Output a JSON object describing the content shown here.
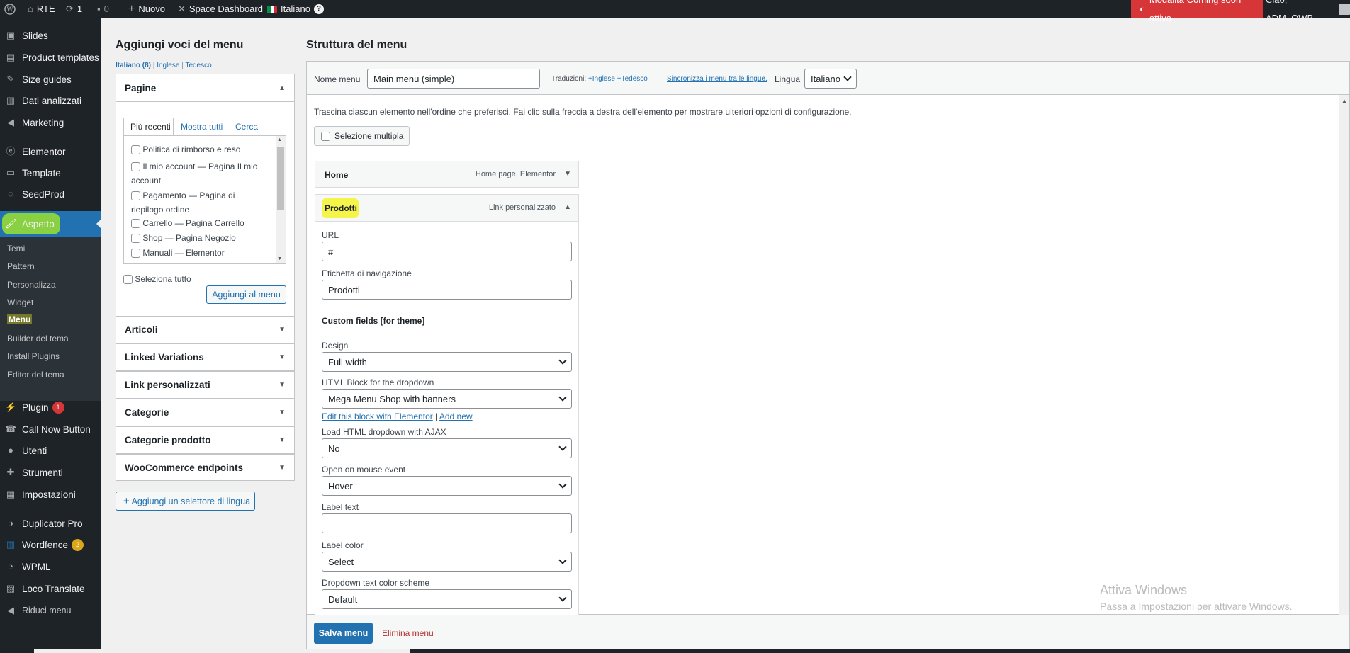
{
  "adminbar": {
    "site": "RTE",
    "updates": "1",
    "comments": "0",
    "new": "Nuovo",
    "space": "Space Dashboard",
    "lang": "Italiano",
    "lang_help": "?",
    "coming_soon": "Modalità Coming soon attiva",
    "greeting": "Ciao, ADM_QWB"
  },
  "sidebar": {
    "items": [
      {
        "label": "Slides",
        "icon": "slides-icon"
      },
      {
        "label": "Product templates",
        "icon": "templates-icon"
      },
      {
        "label": "Size guides",
        "icon": "pin-icon"
      },
      {
        "label": "Dati analizzati",
        "icon": "chart-icon"
      },
      {
        "label": "Marketing",
        "icon": "megaphone-icon"
      },
      {
        "label": "Elementor",
        "icon": "elementor-icon"
      },
      {
        "label": "Template",
        "icon": "folder-icon"
      },
      {
        "label": "SeedProd",
        "icon": "seedprod-icon"
      },
      {
        "label": "Aspetto",
        "icon": "brush-icon"
      }
    ],
    "submenu": [
      "Temi",
      "Pattern",
      "Personalizza",
      "Widget",
      "Menu",
      "Builder del tema",
      "Install Plugins",
      "Editor del tema"
    ],
    "items2": [
      {
        "label": "Plugin",
        "icon": "plugin-icon",
        "badge": "1"
      },
      {
        "label": "Call Now Button",
        "icon": "phone-icon"
      },
      {
        "label": "Utenti",
        "icon": "user-icon"
      },
      {
        "label": "Strumenti",
        "icon": "wrench-icon"
      },
      {
        "label": "Impostazioni",
        "icon": "settings-icon"
      },
      {
        "label": "Duplicator Pro",
        "icon": "duplicator-icon"
      },
      {
        "label": "Wordfence",
        "icon": "wordfence-icon",
        "badge": "2"
      },
      {
        "label": "WPML",
        "icon": "wpml-icon"
      },
      {
        "label": "Loco Translate",
        "icon": "loco-icon"
      },
      {
        "label": "Riduci menu",
        "icon": "collapse-icon"
      }
    ]
  },
  "left": {
    "title": "Aggiungi voci del menu",
    "langs": {
      "it": "Italiano (8)",
      "sep": "|",
      "en": "Inglese",
      "sep2": "|",
      "de": "Tedesco"
    },
    "pagine": {
      "title": "Pagine",
      "tabs": [
        "Più recenti",
        "Mostra tutti",
        "Cerca"
      ],
      "items": [
        "Politica di rimborso e reso",
        "Il mio account — Pagina Il mio account",
        "Pagamento — Pagina di riepilogo ordine",
        "Carrello — Pagina Carrello",
        "Shop — Pagina Negozio",
        "Manuali — Elementor"
      ],
      "select_all": "Seleziona tutto",
      "add_button": "Aggiungi al menu"
    },
    "sections": [
      "Articoli",
      "Linked Variations",
      "Link personalizzati",
      "Categorie",
      "Categorie prodotto",
      "WooCommerce endpoints"
    ],
    "lang_selector": "Aggiungi un selettore di lingua"
  },
  "right": {
    "title": "Struttura del menu",
    "menu_name_label": "Nome menu",
    "menu_name": "Main menu (simple)",
    "translations_label": "Traduzioni:",
    "tr_en": "Inglese",
    "tr_de": "Tedesco",
    "sync": "Sincronizza i menu tra le lingue.",
    "lingua_label": "Lingua",
    "lingua": "Italiano",
    "instructions": "Trascina ciascun elemento nell'ordine che preferisci. Fai clic sulla freccia a destra dell'elemento per mostrare ulteriori opzioni di configurazione.",
    "bulk": "Selezione multipla",
    "home": {
      "title": "Home",
      "meta": "Home page, Elementor"
    },
    "prodotti": {
      "title": "Prodotti",
      "meta": "Link personalizzato",
      "url_label": "URL",
      "url": "#",
      "nav_label": "Etichetta di navigazione",
      "nav": "Prodotti",
      "custom_title": "Custom fields [for theme]",
      "design_label": "Design",
      "design": "Full width",
      "html_label": "HTML Block for the dropdown",
      "html": "Mega Menu Shop with banners",
      "edit_link": "Edit this block with Elementor",
      "sep": "|",
      "add_new": "Add new",
      "ajax_label": "Load HTML dropdown with AJAX",
      "ajax": "No",
      "mouse_label": "Open on mouse event",
      "mouse": "Hover",
      "labeltext_label": "Label text",
      "labeltext": "",
      "labelcolor_label": "Label color",
      "labelcolor": "Select",
      "scheme_label": "Dropdown text color scheme",
      "scheme": "Default"
    },
    "save": "Salva menu",
    "delete": "Elimina menu"
  },
  "watermark": {
    "title": "Attiva Windows",
    "sub": "Passa a Impostazioni per attivare Windows."
  }
}
